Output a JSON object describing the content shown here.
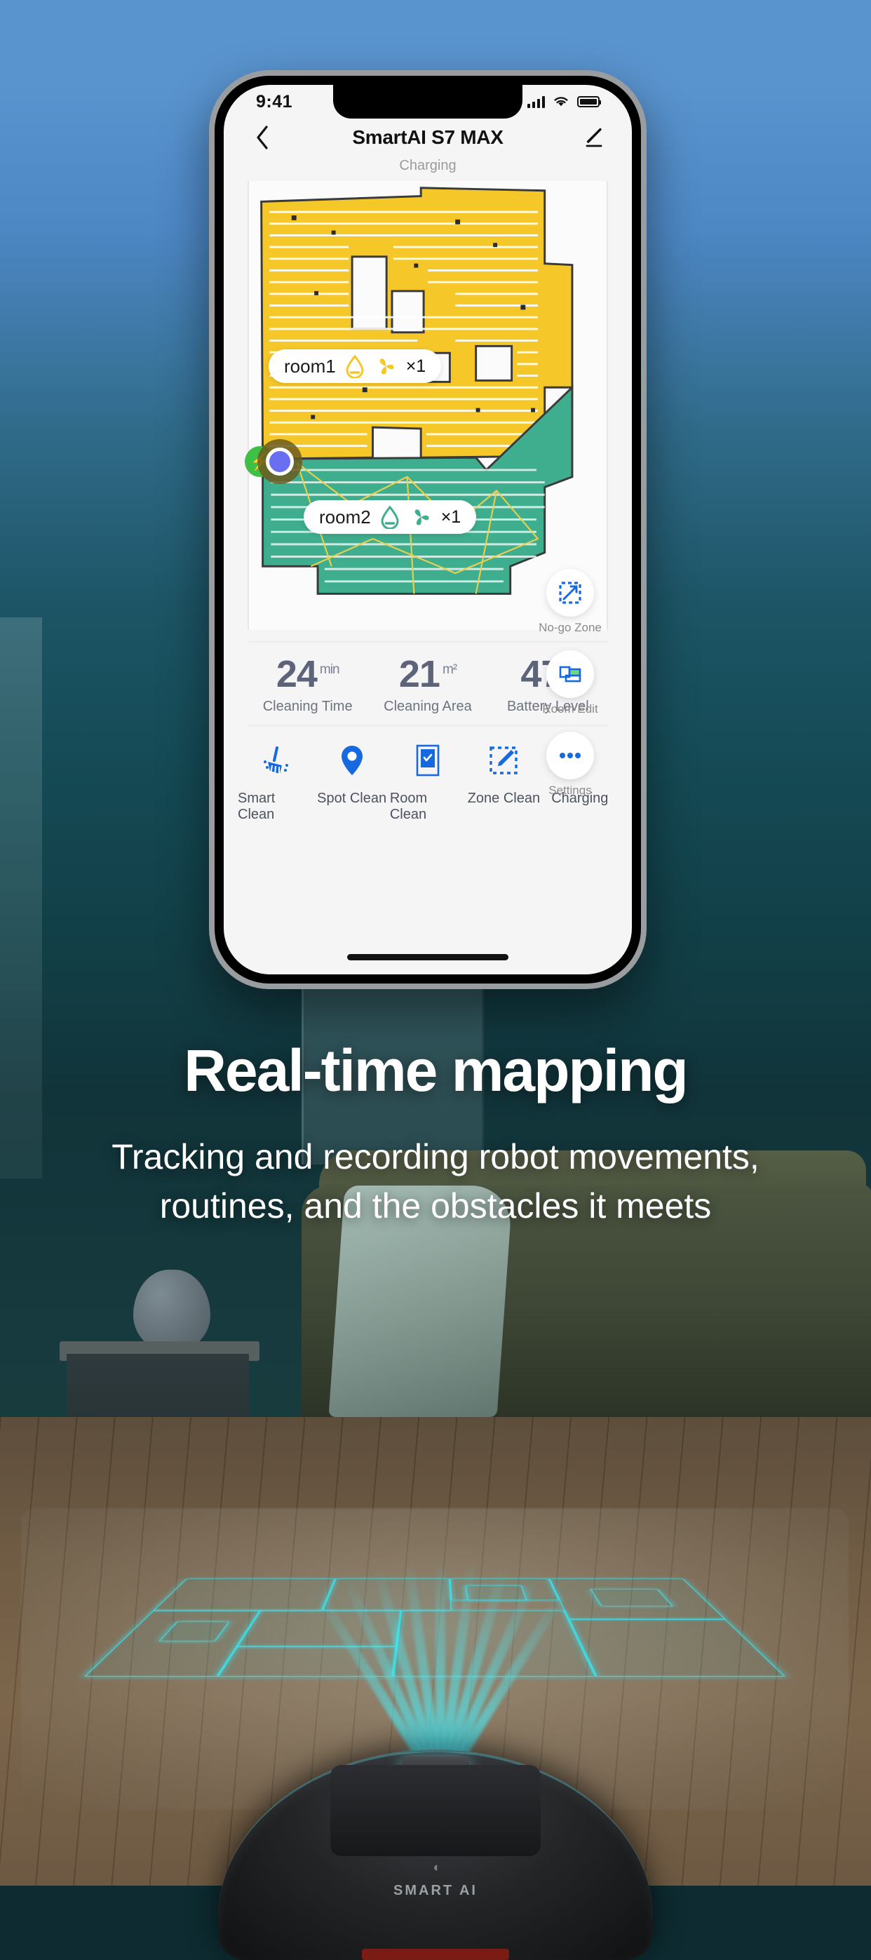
{
  "phone": {
    "statusbar": {
      "time": "9:41",
      "signal_icon": "cellular-signal-icon",
      "wifi_icon": "wifi-icon",
      "battery_icon": "battery-icon"
    },
    "navbar": {
      "back_icon": "chevron-left-icon",
      "title": "SmartAI S7 MAX",
      "edit_icon": "pencil-edit-icon"
    },
    "device_status": "Charging",
    "map": {
      "rooms": [
        {
          "name": "room1",
          "water_icon": "water-drop-icon",
          "suction_icon": "fan-suction-icon",
          "count": "×1",
          "color": "#f5c728"
        },
        {
          "name": "room2",
          "water_icon": "water-drop-icon",
          "suction_icon": "fan-suction-icon",
          "count": "×1",
          "color": "#3fae8f"
        }
      ],
      "robot_marker": "robot-position-marker",
      "dock_marker": "charging-dock-marker"
    },
    "side_tools": [
      {
        "label": "No-go Zone",
        "icon": "no-go-zone-icon"
      },
      {
        "label": "Room Edit",
        "icon": "room-edit-icon"
      },
      {
        "label": "Settings",
        "icon": "more-dots-icon"
      }
    ],
    "stats": [
      {
        "value": "24",
        "unit": "min",
        "label": "Cleaning Time"
      },
      {
        "value": "21",
        "unit": "m²",
        "label": "Cleaning Area"
      },
      {
        "value": "47",
        "unit": "%",
        "label": "Battery Level"
      }
    ],
    "actions": [
      {
        "label": "Smart Clean",
        "icon": "broom-icon",
        "state": "enabled"
      },
      {
        "label": "Spot Clean",
        "icon": "map-pin-icon",
        "state": "enabled"
      },
      {
        "label": "Room Clean",
        "icon": "room-checkbox-icon",
        "state": "enabled"
      },
      {
        "label": "Zone Clean",
        "icon": "zone-pencil-icon",
        "state": "enabled"
      },
      {
        "label": "Charging",
        "icon": "power-plug-icon",
        "state": "dimmed"
      }
    ]
  },
  "marketing": {
    "headline": "Real-time mapping",
    "subline_1": "Tracking and recording robot movements,",
    "subline_2": "routines, and the obstacles it meets"
  },
  "robot_device": {
    "brand": "SMART AI"
  },
  "colors": {
    "accent_blue": "#1769e0",
    "room1_yellow": "#f5c728",
    "room2_green": "#3fae8f",
    "stat_text": "#5d6479",
    "holo_cyan": "#3ce1eb"
  }
}
